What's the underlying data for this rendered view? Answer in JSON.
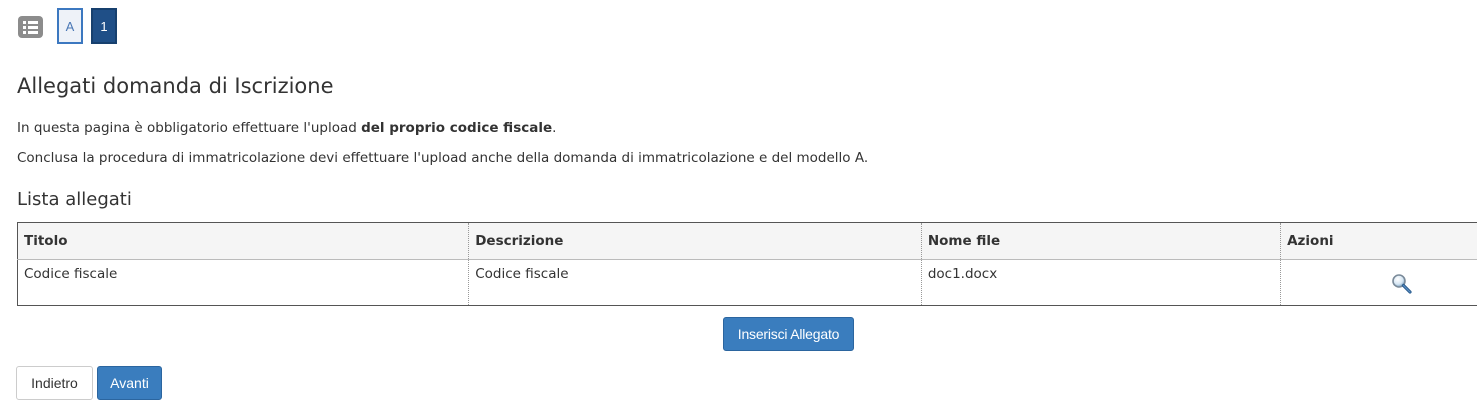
{
  "stepbar": {
    "icon": "list-icon",
    "steps": [
      {
        "label": "A",
        "state": "visited"
      },
      {
        "label": "1",
        "state": "active"
      }
    ]
  },
  "page": {
    "title": "Allegati domanda di Iscrizione",
    "intro_prefix": "In questa pagina è obbligatorio effettuare l'upload ",
    "intro_bold": "del proprio codice fiscale",
    "intro_suffix": ".",
    "note": "Conclusa la procedura di immatricolazione devi effettuare l'upload anche della domanda di immatricolazione e del modello A."
  },
  "attachments": {
    "heading": "Lista allegati",
    "columns": [
      "Titolo",
      "Descrizione",
      "Nome file",
      "Azioni"
    ],
    "rows": [
      {
        "titolo": "Codice fiscale",
        "descrizione": "Codice fiscale",
        "nome_file": "doc1.docx",
        "action_icon": "magnifier-icon"
      }
    ]
  },
  "buttons": {
    "insert": "Inserisci Allegato",
    "back": "Indietro",
    "next": "Avanti"
  },
  "colors": {
    "primary": "#3a7dbe",
    "step_active": "#1f4f87",
    "step_visited_border": "#3c78c0"
  }
}
